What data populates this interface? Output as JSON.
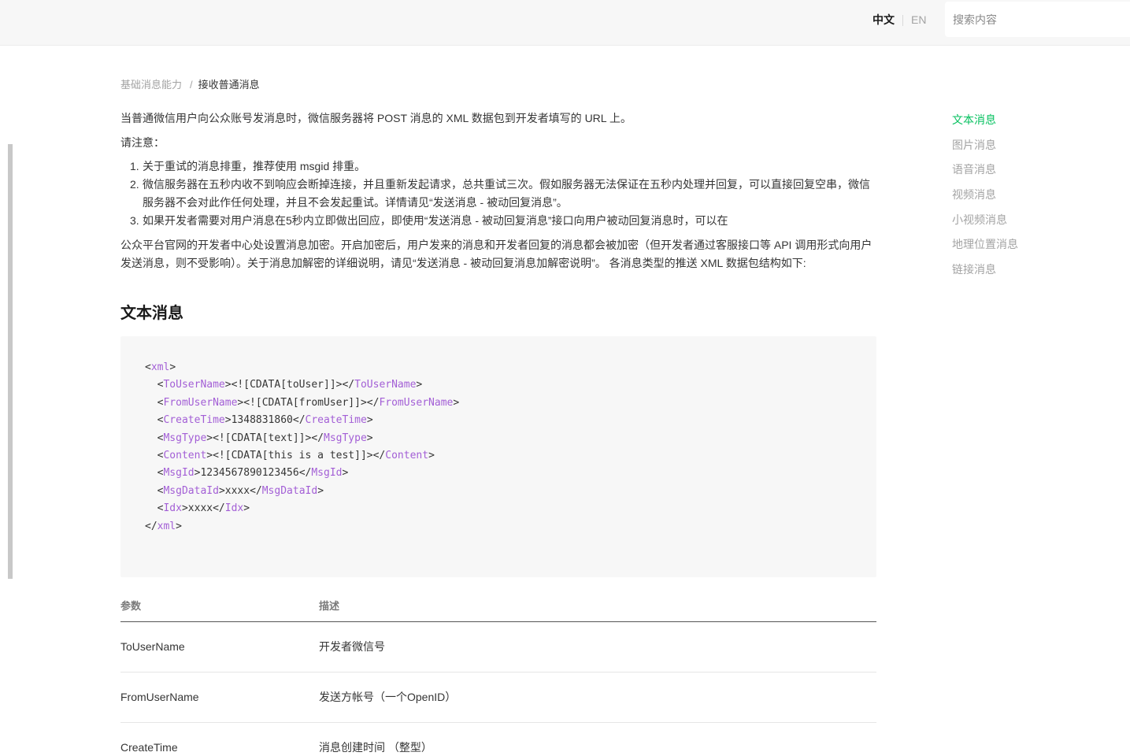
{
  "header": {
    "lang_zh": "中文",
    "lang_en": "EN",
    "search_placeholder": "搜索内容"
  },
  "breadcrumb": {
    "parent": "基础消息能力",
    "separator": "/",
    "current": "接收普通消息"
  },
  "intro": {
    "p1": "当普通微信用户向公众账号发消息时，微信服务器将 POST 消息的 XML 数据包到开发者填写的 URL 上。",
    "p2": "请注意：",
    "notes": [
      {
        "num": "1.",
        "text": "关于重试的消息排重，推荐使用 msgid 排重。"
      },
      {
        "num": "2.",
        "text": "微信服务器在五秒内收不到响应会断掉连接，并且重新发起请求，总共重试三次。假如服务器无法保证在五秒内处理并回复，可以直接回复空串，微信服务器不会对此作任何处理，并且不会发起重试。详情请见“发送消息 - 被动回复消息”。"
      },
      {
        "num": "3.",
        "text": "如果开发者需要对用户消息在5秒内立即做出回应，即使用“发送消息 - 被动回复消息”接口向用户被动回复消息时，可以在"
      }
    ],
    "p3": "公众平台官网的开发者中心处设置消息加密。开启加密后，用户发来的消息和开发者回复的消息都会被加密（但开发者通过客服接口等 API 调用形式向用户发送消息，则不受影响）。关于消息加解密的详细说明，请见“发送消息 - 被动回复消息加解密说明”。 各消息类型的推送 XML 数据包结构如下:"
  },
  "section": {
    "title": "文本消息"
  },
  "code": {
    "lines": [
      {
        "indent": "",
        "tag": "xml",
        "value": "",
        "close": false
      },
      {
        "indent": "  ",
        "tag": "ToUserName",
        "value": "<![CDATA[toUser]]>",
        "close": true
      },
      {
        "indent": "  ",
        "tag": "FromUserName",
        "value": "<![CDATA[fromUser]]>",
        "close": true
      },
      {
        "indent": "  ",
        "tag": "CreateTime",
        "value": "1348831860",
        "close": true
      },
      {
        "indent": "  ",
        "tag": "MsgType",
        "value": "<![CDATA[text]]>",
        "close": true
      },
      {
        "indent": "  ",
        "tag": "Content",
        "value": "<![CDATA[this is a test]]>",
        "close": true
      },
      {
        "indent": "  ",
        "tag": "MsgId",
        "value": "1234567890123456",
        "close": true
      },
      {
        "indent": "  ",
        "tag": "MsgDataId",
        "value": "xxxx",
        "close": true
      },
      {
        "indent": "  ",
        "tag": "Idx",
        "value": "xxxx",
        "close": true
      },
      {
        "indent": "",
        "tag": "/xml",
        "value": "",
        "close": false
      }
    ]
  },
  "table": {
    "headers": [
      "参数",
      "描述"
    ],
    "rows": [
      [
        "ToUserName",
        "开发者微信号"
      ],
      [
        "FromUserName",
        "发送方帐号（一个OpenID）"
      ],
      [
        "CreateTime",
        "消息创建时间 （整型）"
      ]
    ]
  },
  "toc": {
    "items": [
      "文本消息",
      "图片消息",
      "语音消息",
      "视频消息",
      "小视频消息",
      "地理位置消息",
      "链接消息"
    ],
    "active_index": 0
  },
  "colors": {
    "accent": "#07c160",
    "tag": "#a35fd6",
    "muted": "#a3a3a3",
    "text": "#353535"
  }
}
